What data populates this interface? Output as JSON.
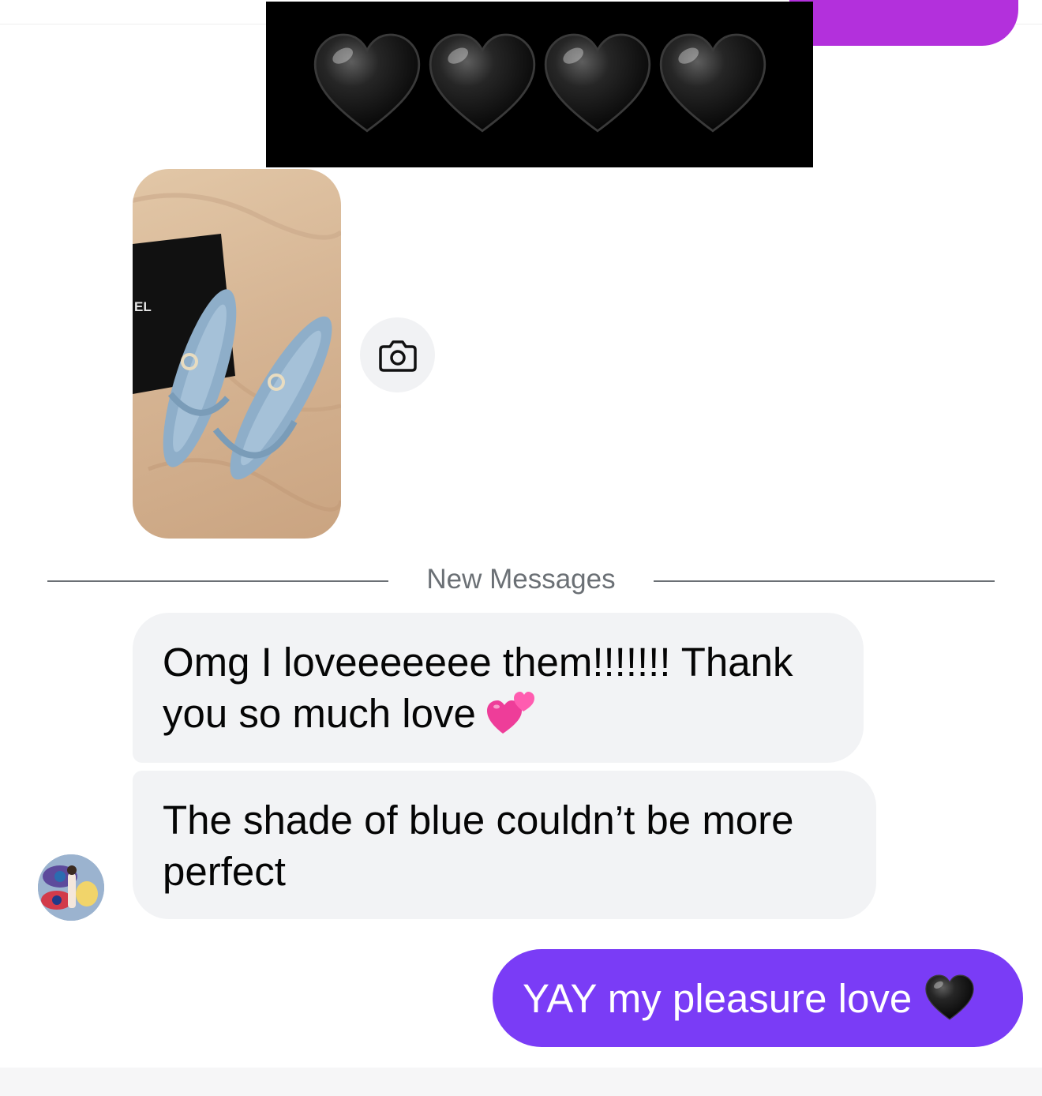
{
  "thread": {
    "redaction_icon": "black-heart-emoji",
    "redaction_count": 4,
    "photo_caption": "",
    "photo_brand_text": "CHANEL",
    "camera_button_icon": "camera-icon"
  },
  "divider": {
    "label": "New Messages"
  },
  "messages": [
    {
      "from": "other",
      "text": "Omg I loveeeeeee them!!!!!!! Thank you so much love",
      "emoji": "two-hearts-emoji"
    },
    {
      "from": "other",
      "text": "The shade of blue couldn’t be more perfect"
    },
    {
      "from": "me",
      "text": "YAY my pleasure love",
      "emoji": "black-heart-emoji"
    }
  ],
  "colors": {
    "outgoing_bubble": "#7a3cf6",
    "previous_bubble": "#b330dc",
    "incoming_bubble": "#f2f3f5",
    "divider_text": "#6b7075"
  }
}
